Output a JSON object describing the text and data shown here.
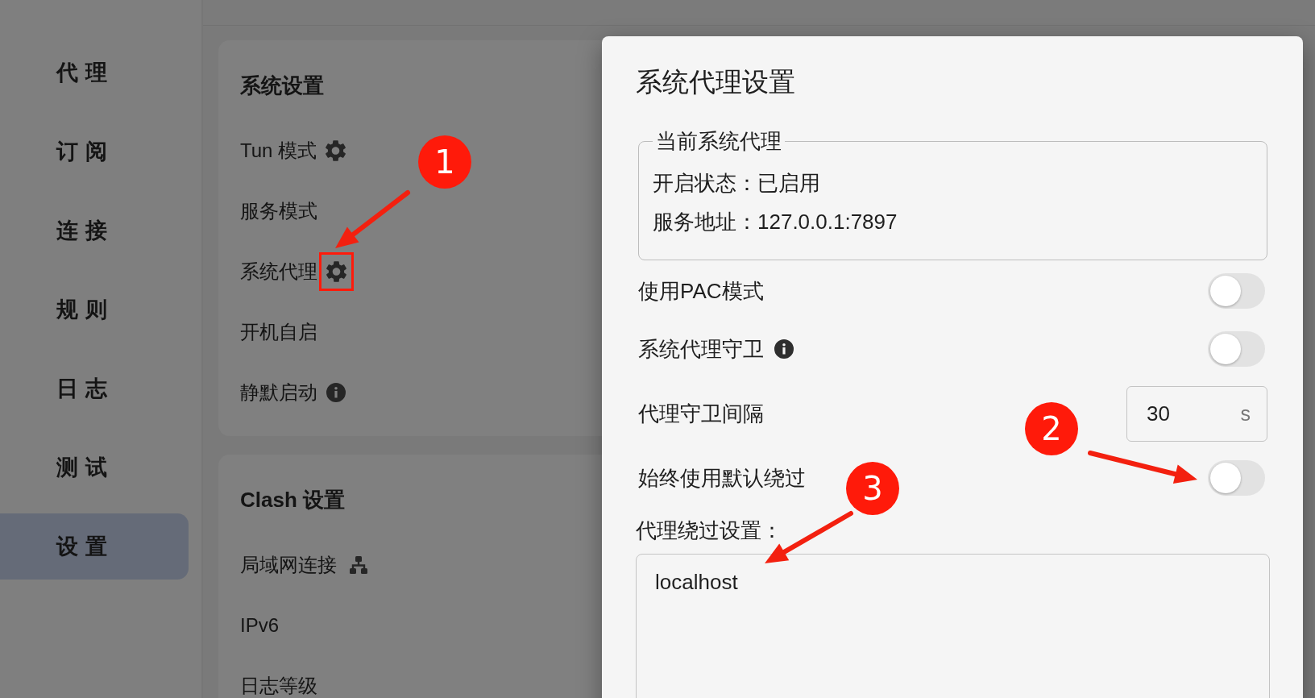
{
  "sidebar": {
    "items": [
      {
        "label": "代理",
        "selected": false
      },
      {
        "label": "订阅",
        "selected": false
      },
      {
        "label": "连接",
        "selected": false
      },
      {
        "label": "规则",
        "selected": false
      },
      {
        "label": "日志",
        "selected": false
      },
      {
        "label": "测试",
        "selected": false
      },
      {
        "label": "设置",
        "selected": true
      }
    ]
  },
  "sections": [
    {
      "title": "系统设置",
      "items": [
        {
          "label": "Tun 模式",
          "highlighted": false
        },
        {
          "label": "服务模式",
          "highlighted": false
        },
        {
          "label": "系统代理",
          "highlighted": true
        },
        {
          "label": "开机自启",
          "highlighted": false
        },
        {
          "label": "静默启动",
          "highlighted": false
        }
      ]
    },
    {
      "title": "Clash 设置",
      "items": [
        {
          "label": "局域网连接",
          "highlighted": false
        },
        {
          "label": "IPv6",
          "highlighted": false
        },
        {
          "label": "日志等级",
          "highlighted": false
        }
      ]
    }
  ],
  "dialog": {
    "title": "系统代理设置",
    "current_proxy": {
      "legend": "当前系统代理",
      "lines": [
        "开启状态：已启用",
        "服务地址：127.0.0.1:7897"
      ]
    },
    "rows": [
      {
        "kind": "switch",
        "label": "使用PAC模式",
        "on": false
      },
      {
        "kind": "switch",
        "label": "系统代理守卫",
        "on": false
      },
      {
        "kind": "number",
        "label": "代理守卫间隔",
        "value": "30",
        "unit": "s"
      },
      {
        "kind": "switch",
        "label": "始终使用默认绕过",
        "on": false
      }
    ],
    "bypass": {
      "label": "代理绕过设置：",
      "value": "localhost"
    }
  },
  "annotations": [
    {
      "label": "1"
    },
    {
      "label": "2"
    },
    {
      "label": "3"
    }
  ]
}
